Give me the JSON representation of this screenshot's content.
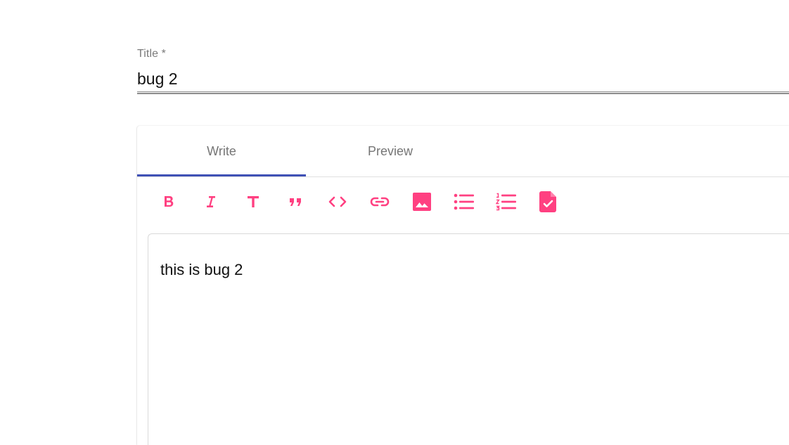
{
  "title_field": {
    "label": "Title *",
    "value": "bug 2"
  },
  "editor": {
    "tabs": [
      {
        "label": "Write",
        "active": true
      },
      {
        "label": "Preview",
        "active": false
      }
    ],
    "toolbar": [
      {
        "icon": "bold-icon"
      },
      {
        "icon": "italic-icon"
      },
      {
        "icon": "header-icon"
      },
      {
        "icon": "quote-icon"
      },
      {
        "icon": "code-icon"
      },
      {
        "icon": "link-icon"
      },
      {
        "icon": "image-icon"
      },
      {
        "icon": "unordered-list-icon"
      },
      {
        "icon": "ordered-list-icon"
      },
      {
        "icon": "checked-list-icon"
      }
    ],
    "content": "this is bug 2"
  },
  "colors": {
    "accent": "#3f51b5",
    "icon": "#ff4081",
    "label": "#757575",
    "underline": "#8c8c8c"
  }
}
